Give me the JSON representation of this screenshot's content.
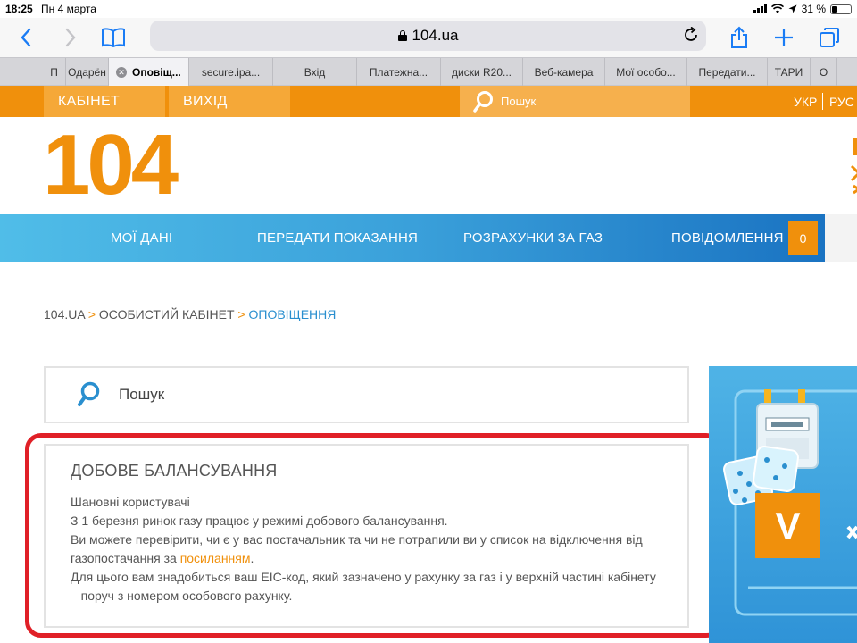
{
  "status_bar": {
    "time": "18:25",
    "date": "Пн 4 марта",
    "battery": "31 %",
    "battery_level": 0.31
  },
  "browser": {
    "url": "104.ua",
    "tabs": [
      {
        "label": "П"
      },
      {
        "label": "Одарён"
      },
      {
        "label": "Оповіщ..."
      },
      {
        "label": "secure.ipa..."
      },
      {
        "label": "Вхід"
      },
      {
        "label": "Платежна..."
      },
      {
        "label": "диски R20..."
      },
      {
        "label": "Веб-камера"
      },
      {
        "label": "Мої особо..."
      },
      {
        "label": "Передати..."
      },
      {
        "label": "ТАРИ"
      },
      {
        "label": "О"
      }
    ],
    "active_tab": 2
  },
  "site": {
    "top_bar": {
      "cabinet": "КАБІНЕТ",
      "logout": "ВИХІД",
      "search_placeholder": "Пошук",
      "lang_uk": "УКР",
      "lang_ru": "РУС"
    },
    "logo": "104",
    "nav": {
      "my_data": "МОЇ ДАНІ",
      "submit_readings": "ПЕРЕДАТИ ПОКАЗАННЯ",
      "gas_payments": "РОЗРАХУНКИ ЗА ГАЗ",
      "notifications": "ПОВІДОМЛЕННЯ",
      "notifications_count": "0"
    },
    "breadcrumb": {
      "home": "104.UA",
      "sep": ">",
      "cabinet": "ОСОБИСТИЙ КАБІНЕТ",
      "current": "ОПОВІЩЕННЯ"
    },
    "search_placeholder": "Пошук",
    "notice": {
      "title": "ДОБОВЕ БАЛАНСУВАННЯ",
      "greeting": "Шановні користувачі",
      "line1": "З 1 березня ринок газу працює у режимі добового балансування.",
      "line2_before": "Ви можете перевірити, чи є у вас постачальник та чи не потрапили ви у список на відключення від газопостачання за ",
      "line2_link": "посиланням",
      "line2_after": ".",
      "line3": "Для цього вам знадобиться ваш EIC-код, який зазначено у рахунку за газ і у верхній частині кабінету – поруч з номером особового рахунку."
    },
    "banner": {
      "letter": "V"
    }
  },
  "colors": {
    "orange": "#f0900c",
    "blue": "#2a8fcf",
    "highlight": "#e02027"
  }
}
